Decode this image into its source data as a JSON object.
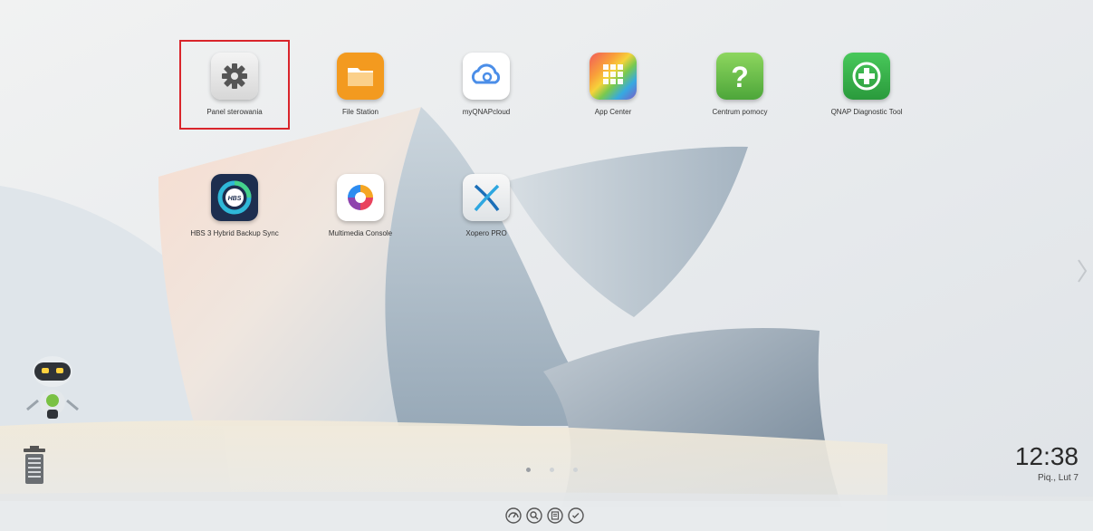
{
  "desktop": {
    "apps_row1": [
      {
        "label": "Panel sterowania",
        "icon": "gear-icon"
      },
      {
        "label": "File Station",
        "icon": "folder-icon"
      },
      {
        "label": "myQNAPcloud",
        "icon": "cloud-icon"
      },
      {
        "label": "App Center",
        "icon": "app-grid-icon"
      },
      {
        "label": "Centrum pomocy",
        "icon": "help-icon"
      },
      {
        "label": "QNAP Diagnostic Tool",
        "icon": "diagnostic-plus-icon"
      }
    ],
    "apps_row2": [
      {
        "label": "HBS 3 Hybrid Backup Sync",
        "icon": "hbs-icon",
        "icon_text": "HBS"
      },
      {
        "label": "Multimedia Console",
        "icon": "multimedia-icon"
      },
      {
        "label": "Xopero PRO",
        "icon": "xopero-icon"
      }
    ],
    "selected_app": "Panel sterowania"
  },
  "pagination": {
    "pages": 3,
    "current": 1
  },
  "clock": {
    "time": "12:38",
    "date": "Piq., Lut 7"
  },
  "dock": {
    "items": [
      "dashboard-icon",
      "search-icon",
      "notes-icon",
      "tasks-icon"
    ]
  },
  "colors": {
    "selection": "#d9252b",
    "file_station": "#f39a1f",
    "app_center": "#e94f64",
    "help": "#6cc04a",
    "diagnostic": "#34b24a",
    "myqnapcloud": "#4b8ee8"
  }
}
